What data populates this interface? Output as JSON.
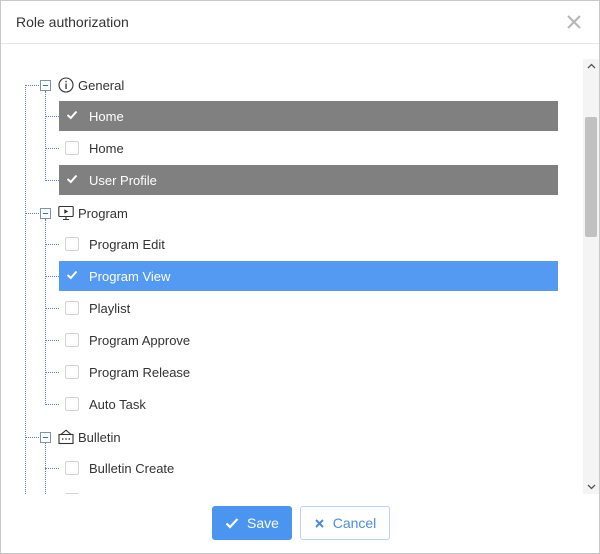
{
  "dialog": {
    "title": "Role authorization"
  },
  "tree": {
    "groups": [
      {
        "label": "General",
        "icon": "info-circle-icon",
        "items": [
          {
            "label": "Home",
            "checked": true,
            "highlight": "gray"
          },
          {
            "label": "Home",
            "checked": false,
            "highlight": "none"
          },
          {
            "label": "User Profile",
            "checked": true,
            "highlight": "gray"
          }
        ]
      },
      {
        "label": "Program",
        "icon": "monitor-play-icon",
        "items": [
          {
            "label": "Program Edit",
            "checked": false,
            "highlight": "none"
          },
          {
            "label": "Program View",
            "checked": true,
            "highlight": "blue"
          },
          {
            "label": "Playlist",
            "checked": false,
            "highlight": "none"
          },
          {
            "label": "Program Approve",
            "checked": false,
            "highlight": "none"
          },
          {
            "label": "Program Release",
            "checked": false,
            "highlight": "none"
          },
          {
            "label": "Auto Task",
            "checked": false,
            "highlight": "none"
          }
        ]
      },
      {
        "label": "Bulletin",
        "icon": "bulletin-board-icon",
        "items": [
          {
            "label": "Bulletin Create",
            "checked": false,
            "highlight": "none"
          }
        ]
      }
    ]
  },
  "footer": {
    "save_label": "Save",
    "cancel_label": "Cancel"
  },
  "colors": {
    "selected_gray": "#808080",
    "selected_blue": "#5499f2",
    "primary_button": "#4a95f0"
  }
}
